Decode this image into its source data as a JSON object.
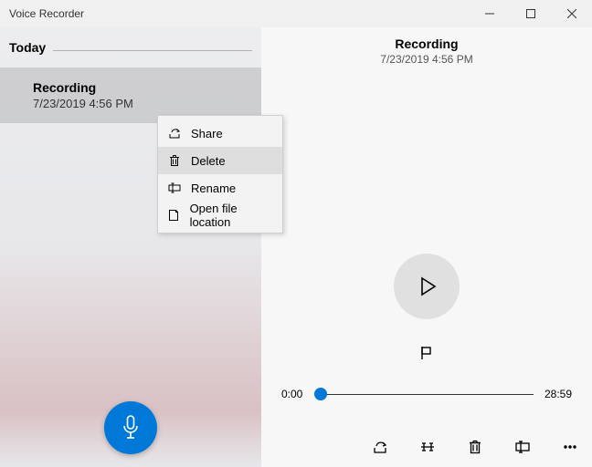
{
  "window": {
    "title": "Voice Recorder"
  },
  "sidebar": {
    "section": "Today",
    "items": [
      {
        "name": "Recording",
        "time": "7/23/2019 4:56 PM"
      }
    ]
  },
  "context_menu": {
    "items": [
      {
        "icon": "share-icon",
        "label": "Share"
      },
      {
        "icon": "delete-icon",
        "label": "Delete"
      },
      {
        "icon": "rename-icon",
        "label": "Rename"
      },
      {
        "icon": "folder-icon",
        "label": "Open file location"
      }
    ],
    "hover_index": 1
  },
  "main": {
    "title": "Recording",
    "time": "7/23/2019 4:56 PM",
    "position": "0:00",
    "duration": "28:59"
  },
  "colors": {
    "accent": "#0078d7"
  }
}
